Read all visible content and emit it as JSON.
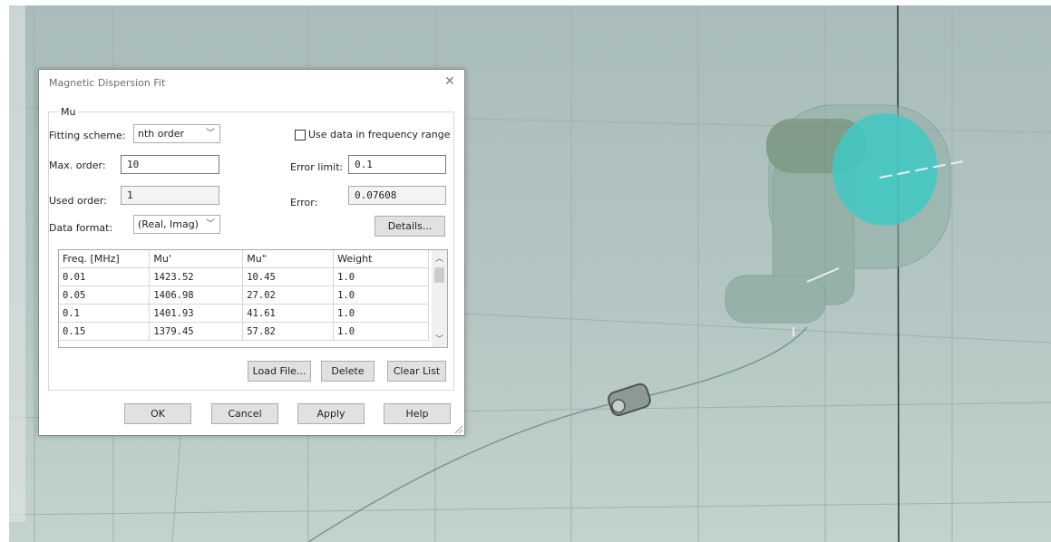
{
  "dialog": {
    "title": "Magnetic Dispersion Fit",
    "close_glyph": "✕",
    "group_label": "Mu",
    "fitting_scheme": {
      "label": "Fitting scheme:",
      "value": "nth order"
    },
    "use_data_range": {
      "label": "Use data in frequency range",
      "checked": false
    },
    "max_order": {
      "label": "Max. order:",
      "value": "10"
    },
    "error_limit": {
      "label": "Error limit:",
      "value": "0.1"
    },
    "used_order": {
      "label": "Used order:",
      "value": "1"
    },
    "error": {
      "label": "Error:",
      "value": "0.07608"
    },
    "data_format": {
      "label": "Data format:",
      "value": "(Real, Imag)"
    },
    "details_label": "Details...",
    "table": {
      "headers": [
        "Freq. [MHz]",
        "Mu'",
        "Mu\"",
        "Weight"
      ],
      "rows": [
        [
          "0.01",
          "1423.52",
          "10.45",
          "1.0"
        ],
        [
          "0.05",
          "1406.98",
          "27.02",
          "1.0"
        ],
        [
          "0.1",
          "1401.93",
          "41.61",
          "1.0"
        ],
        [
          "0.15",
          "1379.45",
          "57.82",
          "1.0"
        ]
      ]
    },
    "load_file_label": "Load File...",
    "delete_label": "Delete",
    "clear_list_label": "Clear List",
    "ok_label": "OK",
    "cancel_label": "Cancel",
    "apply_label": "Apply",
    "help_label": "Help"
  },
  "colors": {
    "viewport_bg": "#b4c6c3",
    "cyan_disc": "#3fc9c4",
    "dialog_bg": "#ffffff"
  }
}
